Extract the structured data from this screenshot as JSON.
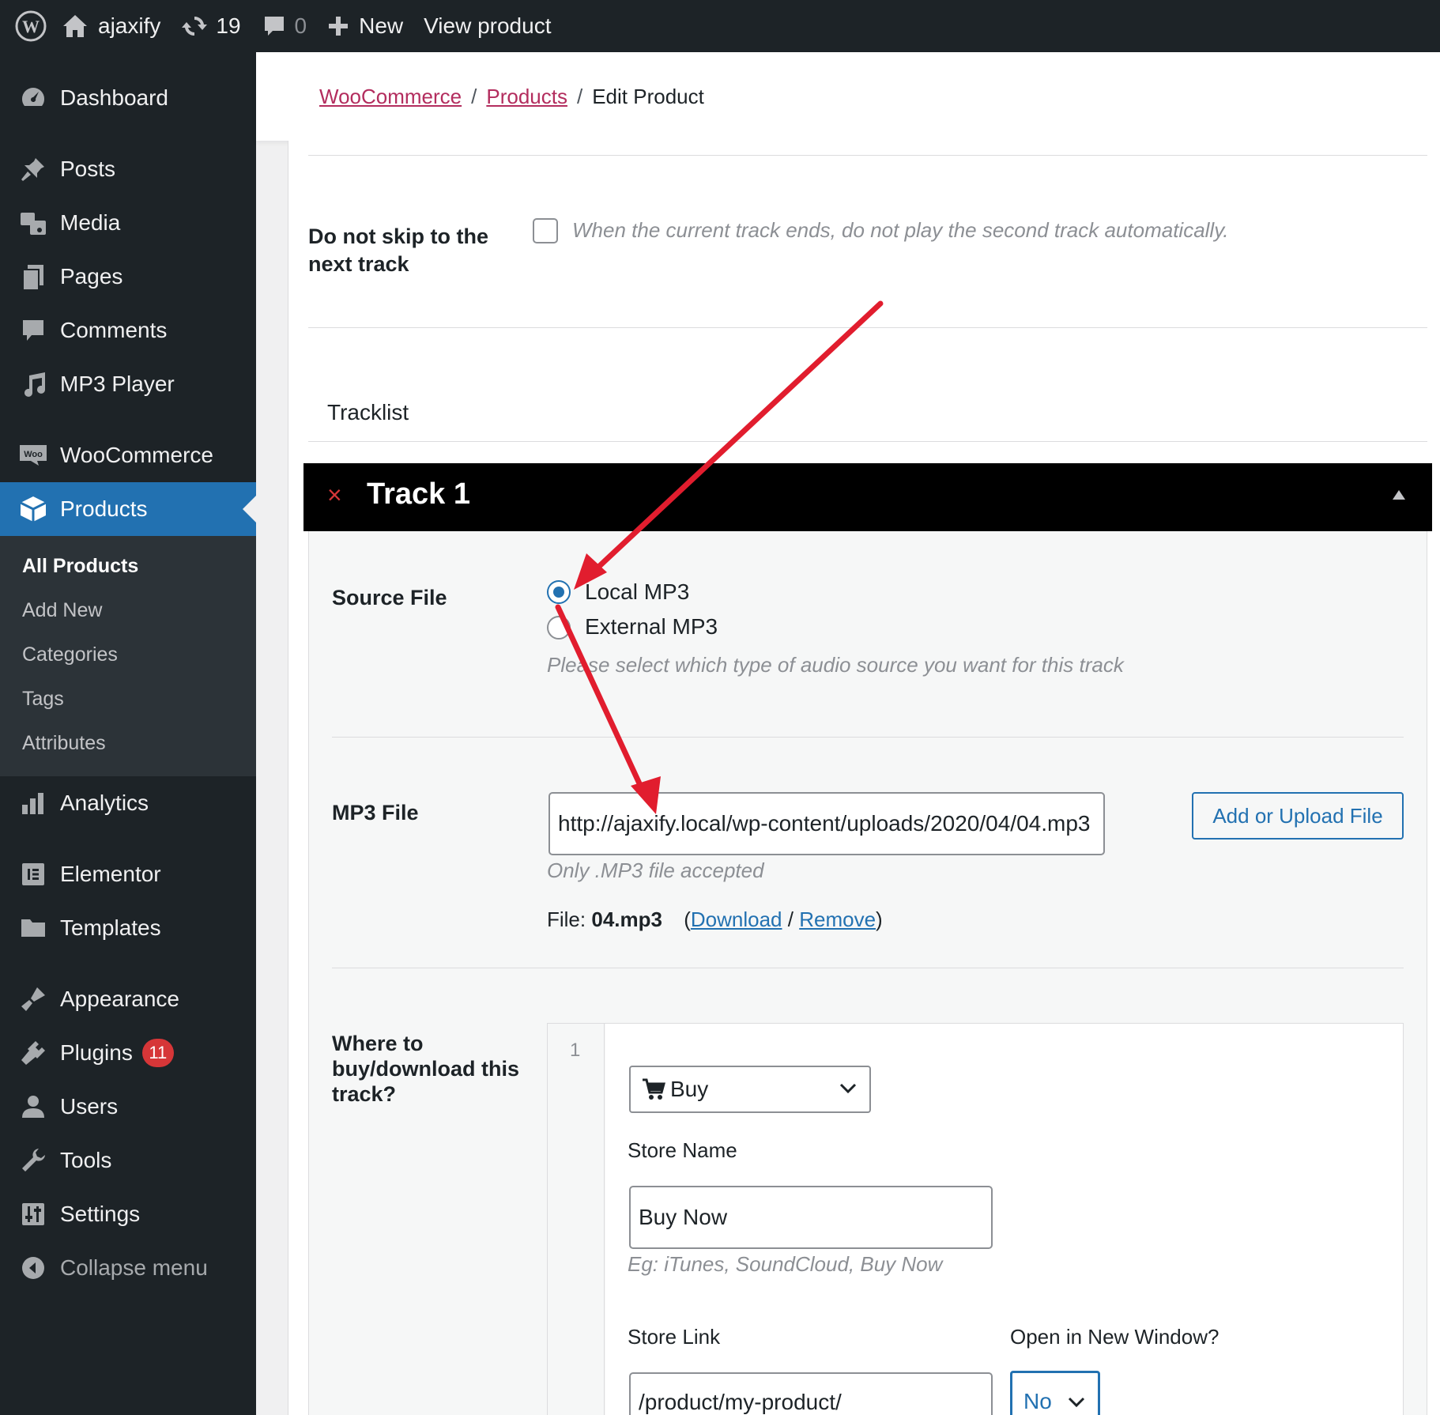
{
  "adminbar": {
    "site_name": "ajaxify",
    "updates_count": "19",
    "comments_count": "0",
    "new_label": "New",
    "view_product_label": "View product"
  },
  "sidebar": {
    "items": [
      {
        "label": "Dashboard",
        "icon": "dashboard-icon"
      },
      {
        "label": "Posts",
        "icon": "pin-icon"
      },
      {
        "label": "Media",
        "icon": "media-icon"
      },
      {
        "label": "Pages",
        "icon": "pages-icon"
      },
      {
        "label": "Comments",
        "icon": "comment-icon"
      },
      {
        "label": "MP3 Player",
        "icon": "music-note-icon"
      },
      {
        "label": "WooCommerce",
        "icon": "woo-icon"
      },
      {
        "label": "Products",
        "icon": "box-icon"
      },
      {
        "label": "Analytics",
        "icon": "bar-chart-icon"
      },
      {
        "label": "Elementor",
        "icon": "elementor-icon"
      },
      {
        "label": "Templates",
        "icon": "folder-icon"
      },
      {
        "label": "Appearance",
        "icon": "brush-icon"
      },
      {
        "label": "Plugins",
        "icon": "plug-icon",
        "badge": "11"
      },
      {
        "label": "Users",
        "icon": "user-icon"
      },
      {
        "label": "Tools",
        "icon": "wrench-icon"
      },
      {
        "label": "Settings",
        "icon": "sliders-icon"
      },
      {
        "label": "Collapse menu",
        "icon": "collapse-icon"
      }
    ],
    "woo_icon_text": "Woo",
    "products_submenu": [
      "All Products",
      "Add New",
      "Categories",
      "Tags",
      "Attributes"
    ]
  },
  "breadcrumb": {
    "woocommerce": "WooCommerce",
    "products": "Products",
    "current": "Edit Product",
    "separator": "/"
  },
  "settings": {
    "skip_label": "Do not skip to the next track",
    "skip_desc": "When the current track ends, do not play the second track automatically.",
    "tracklist_label": "Tracklist"
  },
  "track": {
    "remove_glyph": "×",
    "title": "Track 1",
    "source_label": "Source File",
    "source_options": [
      "Local MP3",
      "External MP3"
    ],
    "source_selected": "Local MP3",
    "source_desc": "Please select which type of audio source you want for this track",
    "mp3_label": "MP3 File",
    "mp3_value": "http://ajaxify.local/wp-content/uploads/2020/04/04.mp3",
    "mp3_button": "Add or Upload File",
    "mp3_desc": "Only .MP3 file accepted",
    "file_prefix": "File:",
    "file_name": "04.mp3",
    "open_paren": "(",
    "download_label": "Download",
    "slash": "/",
    "remove_label": "Remove",
    "close_paren": ")",
    "where_label": "Where to buy/download this track?",
    "repeater_index": "1",
    "buy_select": "Buy",
    "store_name_label": "Store Name",
    "store_name_value": "Buy Now",
    "store_name_desc": "Eg: iTunes, SoundCloud, Buy Now",
    "store_link_label": "Store Link",
    "store_link_value": "/product/my-product/",
    "new_window_label": "Open in New Window?",
    "new_window_value": "No"
  },
  "colors": {
    "accent": "#2271b1",
    "crumb": "#b32d5e",
    "arrow": "#e11d2e",
    "badge": "#d63638"
  }
}
